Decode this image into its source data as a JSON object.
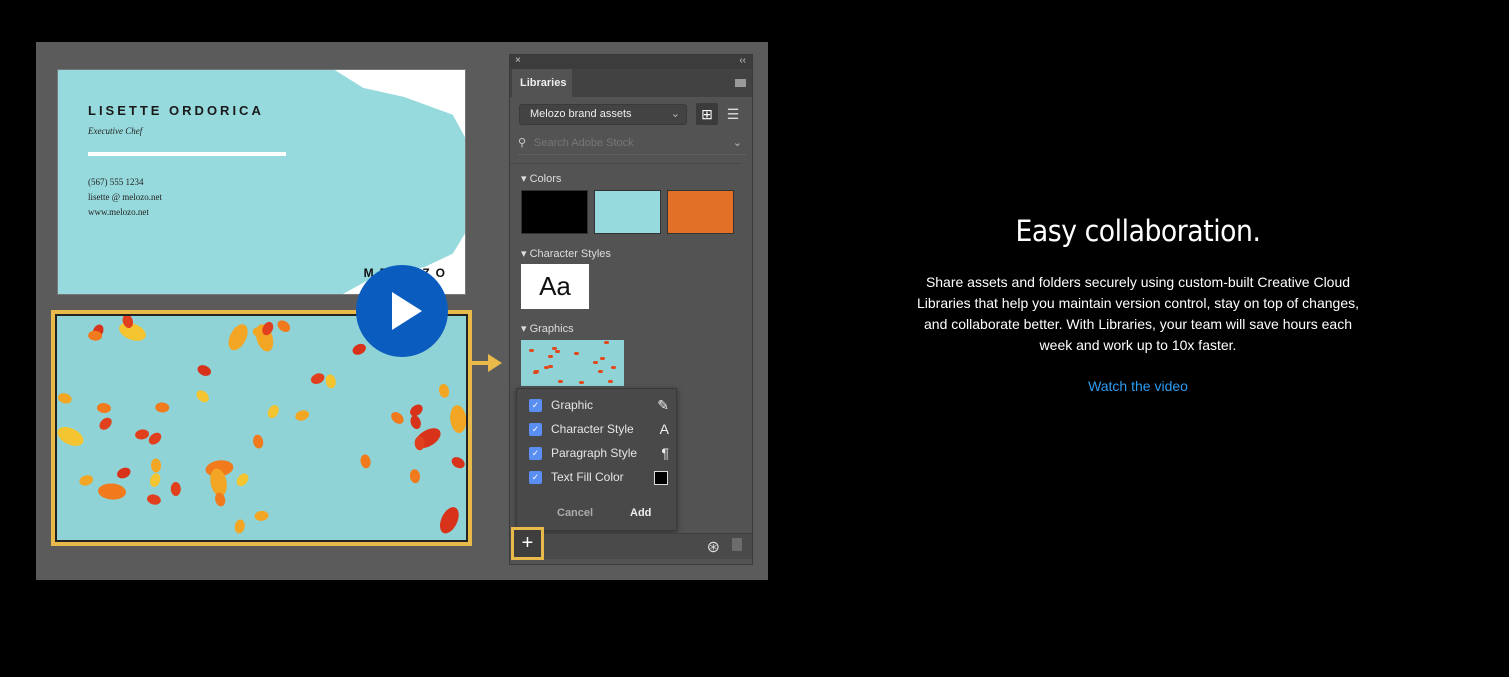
{
  "business_card": {
    "name": "LISETTE ORDORICA",
    "title": "Executive Chef",
    "phone": "(567) 555 1234",
    "email": "lisette @ melozo.net",
    "website": "www.melozo.net",
    "logo": "MELOZO"
  },
  "video": {
    "play_icon": "play-icon",
    "play_color": "#0a5cbf"
  },
  "panel": {
    "close": "×",
    "collapse": "‹‹",
    "tab": "Libraries",
    "library_select": "Melozo brand assets",
    "search_placeholder": "Search Adobe Stock",
    "sections": {
      "colors": "Colors",
      "character_styles": "Character Styles",
      "graphics": "Graphics"
    },
    "colors": [
      "#000000",
      "#97dadd",
      "#e27026"
    ],
    "char_style_sample": "Aa",
    "popup": {
      "options": [
        {
          "label": "Graphic",
          "checked": true,
          "icon": "graphic-icon"
        },
        {
          "label": "Character Style",
          "checked": true,
          "icon": "A"
        },
        {
          "label": "Paragraph Style",
          "checked": true,
          "icon": "¶"
        },
        {
          "label": "Text Fill Color",
          "checked": true,
          "icon": "fill-swatch"
        }
      ],
      "cancel": "Cancel",
      "add": "Add"
    },
    "plus": "+"
  },
  "highlight_color": "#e9b949",
  "copy": {
    "title": "Easy collaboration.",
    "body": "Share assets and folders securely using custom-built Creative Cloud Libraries that help you maintain version control, stay on top of changes, and collaborate better. With Libraries, your team will save hours each week and work up to 10x faster.",
    "link": "Watch the video"
  }
}
